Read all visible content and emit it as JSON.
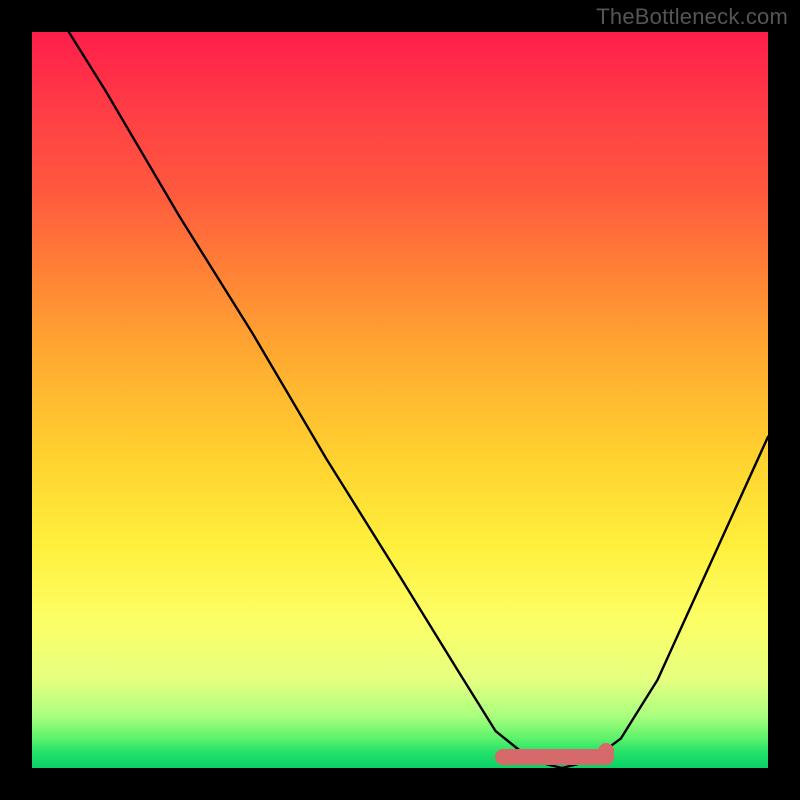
{
  "watermark": "TheBottleneck.com",
  "chart_data": {
    "type": "line",
    "title": "",
    "xlabel": "",
    "ylabel": "",
    "xlim": [
      0,
      100
    ],
    "ylim": [
      0,
      100
    ],
    "grid": false,
    "legend": false,
    "series": [
      {
        "name": "bottleneck-curve",
        "x": [
          5,
          10,
          20,
          30,
          40,
          50,
          58,
          63,
          68,
          72,
          76,
          80,
          85,
          90,
          95,
          100
        ],
        "values": [
          100,
          92,
          75,
          59,
          42,
          26,
          13,
          5,
          1,
          0,
          1,
          4,
          12,
          23,
          34,
          45
        ]
      }
    ],
    "highlight": {
      "name": "optimal-zone",
      "x_range": [
        64,
        78
      ],
      "y": 0
    },
    "background_gradient": {
      "top_color": "#ff1e4b",
      "mid_color": "#ffd22f",
      "bottom_color": "#0bd166"
    }
  }
}
